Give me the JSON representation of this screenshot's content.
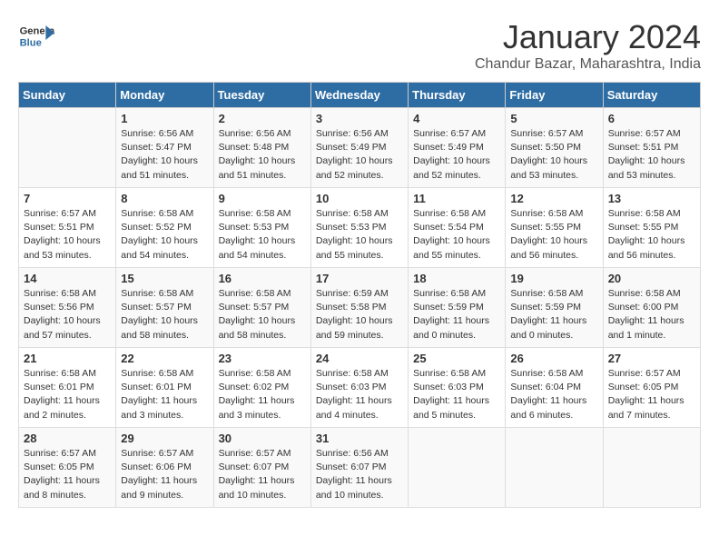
{
  "header": {
    "logo_line1": "General",
    "logo_line2": "Blue",
    "month_title": "January 2024",
    "subtitle": "Chandur Bazar, Maharashtra, India"
  },
  "days_of_week": [
    "Sunday",
    "Monday",
    "Tuesday",
    "Wednesday",
    "Thursday",
    "Friday",
    "Saturday"
  ],
  "weeks": [
    [
      {
        "day": "",
        "info": ""
      },
      {
        "day": "1",
        "info": "Sunrise: 6:56 AM\nSunset: 5:47 PM\nDaylight: 10 hours\nand 51 minutes."
      },
      {
        "day": "2",
        "info": "Sunrise: 6:56 AM\nSunset: 5:48 PM\nDaylight: 10 hours\nand 51 minutes."
      },
      {
        "day": "3",
        "info": "Sunrise: 6:56 AM\nSunset: 5:49 PM\nDaylight: 10 hours\nand 52 minutes."
      },
      {
        "day": "4",
        "info": "Sunrise: 6:57 AM\nSunset: 5:49 PM\nDaylight: 10 hours\nand 52 minutes."
      },
      {
        "day": "5",
        "info": "Sunrise: 6:57 AM\nSunset: 5:50 PM\nDaylight: 10 hours\nand 53 minutes."
      },
      {
        "day": "6",
        "info": "Sunrise: 6:57 AM\nSunset: 5:51 PM\nDaylight: 10 hours\nand 53 minutes."
      }
    ],
    [
      {
        "day": "7",
        "info": "Sunrise: 6:57 AM\nSunset: 5:51 PM\nDaylight: 10 hours\nand 53 minutes."
      },
      {
        "day": "8",
        "info": "Sunrise: 6:58 AM\nSunset: 5:52 PM\nDaylight: 10 hours\nand 54 minutes."
      },
      {
        "day": "9",
        "info": "Sunrise: 6:58 AM\nSunset: 5:53 PM\nDaylight: 10 hours\nand 54 minutes."
      },
      {
        "day": "10",
        "info": "Sunrise: 6:58 AM\nSunset: 5:53 PM\nDaylight: 10 hours\nand 55 minutes."
      },
      {
        "day": "11",
        "info": "Sunrise: 6:58 AM\nSunset: 5:54 PM\nDaylight: 10 hours\nand 55 minutes."
      },
      {
        "day": "12",
        "info": "Sunrise: 6:58 AM\nSunset: 5:55 PM\nDaylight: 10 hours\nand 56 minutes."
      },
      {
        "day": "13",
        "info": "Sunrise: 6:58 AM\nSunset: 5:55 PM\nDaylight: 10 hours\nand 56 minutes."
      }
    ],
    [
      {
        "day": "14",
        "info": "Sunrise: 6:58 AM\nSunset: 5:56 PM\nDaylight: 10 hours\nand 57 minutes."
      },
      {
        "day": "15",
        "info": "Sunrise: 6:58 AM\nSunset: 5:57 PM\nDaylight: 10 hours\nand 58 minutes."
      },
      {
        "day": "16",
        "info": "Sunrise: 6:58 AM\nSunset: 5:57 PM\nDaylight: 10 hours\nand 58 minutes."
      },
      {
        "day": "17",
        "info": "Sunrise: 6:59 AM\nSunset: 5:58 PM\nDaylight: 10 hours\nand 59 minutes."
      },
      {
        "day": "18",
        "info": "Sunrise: 6:58 AM\nSunset: 5:59 PM\nDaylight: 11 hours\nand 0 minutes."
      },
      {
        "day": "19",
        "info": "Sunrise: 6:58 AM\nSunset: 5:59 PM\nDaylight: 11 hours\nand 0 minutes."
      },
      {
        "day": "20",
        "info": "Sunrise: 6:58 AM\nSunset: 6:00 PM\nDaylight: 11 hours\nand 1 minute."
      }
    ],
    [
      {
        "day": "21",
        "info": "Sunrise: 6:58 AM\nSunset: 6:01 PM\nDaylight: 11 hours\nand 2 minutes."
      },
      {
        "day": "22",
        "info": "Sunrise: 6:58 AM\nSunset: 6:01 PM\nDaylight: 11 hours\nand 3 minutes."
      },
      {
        "day": "23",
        "info": "Sunrise: 6:58 AM\nSunset: 6:02 PM\nDaylight: 11 hours\nand 3 minutes."
      },
      {
        "day": "24",
        "info": "Sunrise: 6:58 AM\nSunset: 6:03 PM\nDaylight: 11 hours\nand 4 minutes."
      },
      {
        "day": "25",
        "info": "Sunrise: 6:58 AM\nSunset: 6:03 PM\nDaylight: 11 hours\nand 5 minutes."
      },
      {
        "day": "26",
        "info": "Sunrise: 6:58 AM\nSunset: 6:04 PM\nDaylight: 11 hours\nand 6 minutes."
      },
      {
        "day": "27",
        "info": "Sunrise: 6:57 AM\nSunset: 6:05 PM\nDaylight: 11 hours\nand 7 minutes."
      }
    ],
    [
      {
        "day": "28",
        "info": "Sunrise: 6:57 AM\nSunset: 6:05 PM\nDaylight: 11 hours\nand 8 minutes."
      },
      {
        "day": "29",
        "info": "Sunrise: 6:57 AM\nSunset: 6:06 PM\nDaylight: 11 hours\nand 9 minutes."
      },
      {
        "day": "30",
        "info": "Sunrise: 6:57 AM\nSunset: 6:07 PM\nDaylight: 11 hours\nand 10 minutes."
      },
      {
        "day": "31",
        "info": "Sunrise: 6:56 AM\nSunset: 6:07 PM\nDaylight: 11 hours\nand 10 minutes."
      },
      {
        "day": "",
        "info": ""
      },
      {
        "day": "",
        "info": ""
      },
      {
        "day": "",
        "info": ""
      }
    ]
  ]
}
